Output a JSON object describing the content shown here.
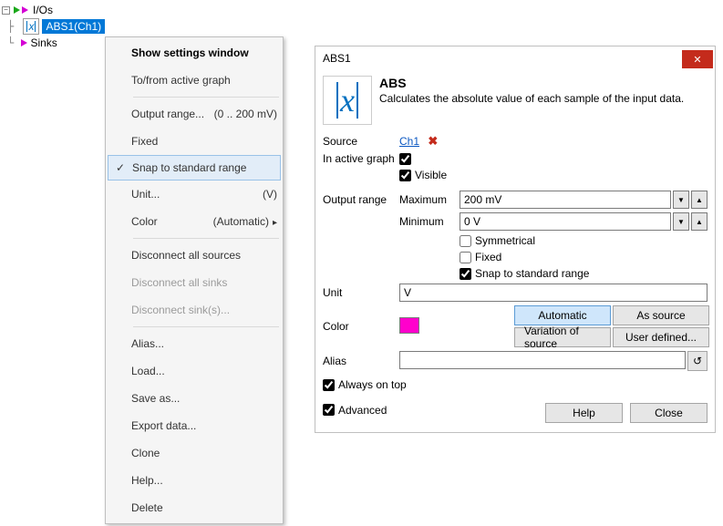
{
  "tree": {
    "root": "I/Os",
    "abs_node": "ABS1(Ch1)",
    "sinks": "Sinks"
  },
  "context_menu": {
    "show_settings": "Show settings window",
    "to_from_graph": "To/from active graph",
    "output_range": "Output range...",
    "output_range_hint": "(0 .. 200 mV)",
    "fixed": "Fixed",
    "snap": "Snap to standard range",
    "unit": "Unit...",
    "unit_hint": "(V)",
    "color": "Color",
    "color_hint": "(Automatic)",
    "disconnect_sources": "Disconnect all sources",
    "disconnect_sinks": "Disconnect all sinks",
    "disconnect_sink": "Disconnect sink(s)...",
    "alias": "Alias...",
    "load": "Load...",
    "save_as": "Save as...",
    "export_data": "Export data...",
    "clone": "Clone",
    "help": "Help...",
    "delete": "Delete"
  },
  "settings": {
    "title": "ABS1",
    "header_title": "ABS",
    "header_desc": "Calculates the absolute value of each sample of the input data.",
    "source_label": "Source",
    "source_value": "Ch1",
    "in_active_graph_label": "In active graph",
    "visible_label": "Visible",
    "output_range_label": "Output range",
    "max_label": "Maximum",
    "max_value": "200 mV",
    "min_label": "Minimum",
    "min_value": "0 V",
    "symmetrical_label": "Symmetrical",
    "fixed_label": "Fixed",
    "snap_label": "Snap to standard range",
    "unit_label": "Unit",
    "unit_value": "V",
    "color_label": "Color",
    "color_value": "#ff00cc",
    "automatic_btn": "Automatic",
    "as_source_btn": "As source",
    "variation_btn": "Variation of source",
    "user_defined_btn": "User defined...",
    "alias_label": "Alias",
    "alias_value": "",
    "always_on_top": "Always on top",
    "advanced": "Advanced",
    "help_btn": "Help",
    "close_btn": "Close",
    "reset_icon": "↺"
  }
}
